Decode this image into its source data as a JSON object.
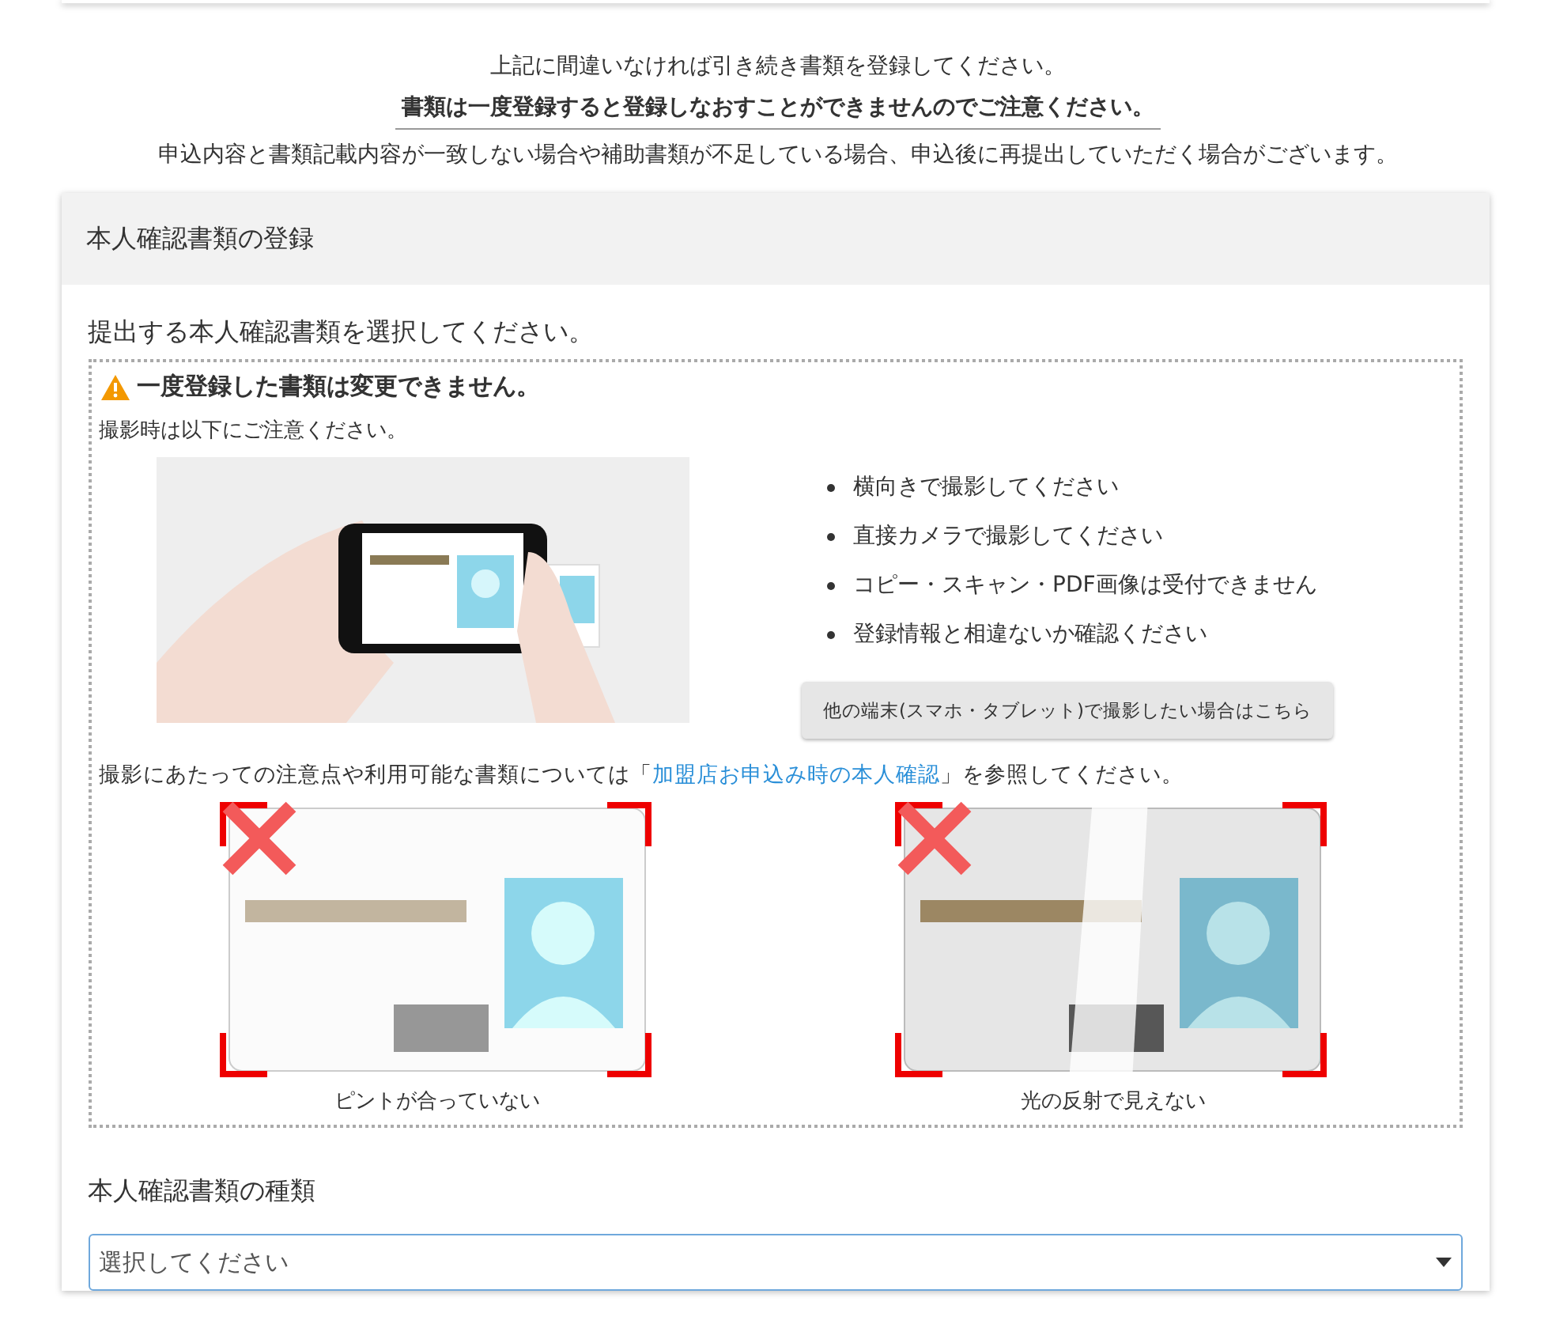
{
  "notice": {
    "line_1": "上記に間違いなければ引き続き書類を登録してください。",
    "line_2": "書類は一度登録すると登録しなおすことができませんのでご注意ください。",
    "line_3": "申込内容と書類記載内容が一致しない場合や補助書類が不足している場合、申込後に再提出していただく場合がございます。"
  },
  "panel": {
    "title": "本人確認書類の登録",
    "prompt": "提出する本人確認書類を選択してください。",
    "warning": {
      "title": "一度登録した書類は変更できません。",
      "intro": "撮影時は以下にご注意ください。",
      "tips": [
        "横向きで撮影してください",
        "直接カメラで撮影してください",
        "コピー・スキャン・PDF画像は受付できません",
        "登録情報と相違ないか確認ください"
      ],
      "other_device_button": "他の端末(スマホ・タブレット)で撮影したい場合はこちら",
      "reference": {
        "before": "撮影にあたっての注意点や利用可能な書類については「",
        "link": "加盟店お申込み時の本人確認",
        "after": "」を参照してください。"
      },
      "examples": [
        {
          "caption": "ピントが合っていない",
          "kind": "blurry"
        },
        {
          "caption": "光の反射で見えない",
          "kind": "glare"
        }
      ]
    },
    "document_type": {
      "label": "本人確認書類の種類",
      "placeholder": "選択してください"
    }
  }
}
